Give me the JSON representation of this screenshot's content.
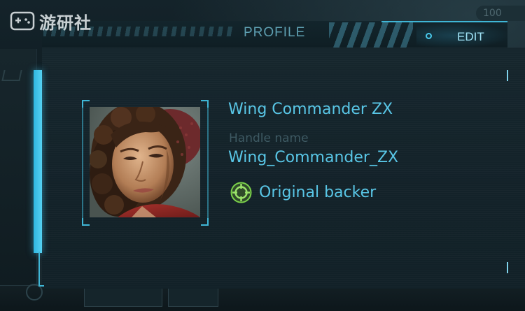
{
  "watermark": {
    "text": "游研社"
  },
  "header": {
    "title": "PROFILE",
    "edit_label": "EDIT"
  },
  "profile": {
    "display_name": "Wing Commander ZX",
    "handle_label": "Handle name",
    "handle_value": "Wing_Commander_ZX",
    "badge_label": "Original backer",
    "badge_icon": "crosshair-badge-icon"
  },
  "background": {
    "top_right_text": "100"
  },
  "colors": {
    "accent": "#59c6e6",
    "accent_bright": "#49c8ea",
    "muted_label": "#3e5a63",
    "panel": "#142329",
    "badge_green": "#7bd24a"
  }
}
